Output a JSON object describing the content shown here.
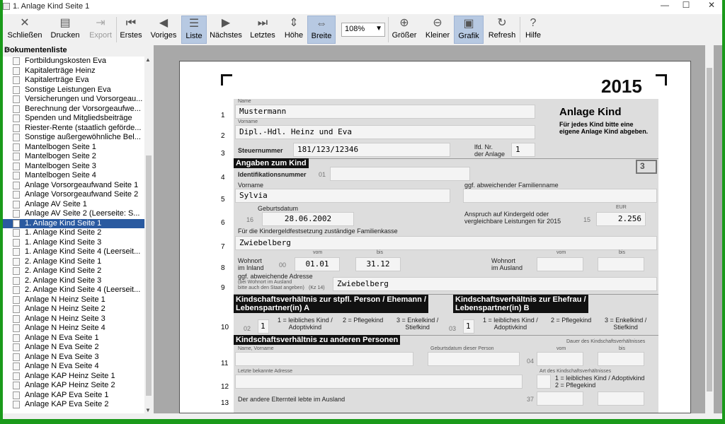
{
  "window": {
    "title": "1. Anlage Kind Seite 1",
    "minimize": "—",
    "maximize": "☐",
    "close": "✕"
  },
  "toolbar": {
    "schliessen": "Schließen",
    "drucken": "Drucken",
    "export": "Export",
    "erstes": "Erstes",
    "voriges": "Voriges",
    "liste": "Liste",
    "naechstes": "Nächstes",
    "letztes": "Letztes",
    "hoehe": "Höhe",
    "breite": "Breite",
    "zoom": "108%",
    "groesser": "Größer",
    "kleiner": "Kleiner",
    "grafik": "Grafik",
    "refresh": "Refresh",
    "hilfe": "Hilfe"
  },
  "sidebar": {
    "title": "Dokumentenliste",
    "items": [
      "Fortbildungskosten Eva",
      "Kapitalerträge Heinz",
      "Kapitalerträge Eva",
      "Sonstige Leistungen Eva",
      "Versicherungen und Vorsorgeau...",
      "Berechnung der Vorsorgeaufwe...",
      "Spenden und Mitgliedsbeiträge",
      "Riester-Rente (staatlich geförde...",
      "Sonstige außergewöhnliche Bel...",
      "Mantelbogen Seite 1",
      "Mantelbogen Seite 2",
      "Mantelbogen Seite 3",
      "Mantelbogen Seite 4",
      "Anlage Vorsorgeaufwand Seite 1",
      "Anlage Vorsorgeaufwand Seite 2",
      "Anlage AV Seite 1",
      "Anlage AV Seite 2 (Leerseite: S...",
      "1. Anlage Kind Seite 1",
      "1. Anlage Kind Seite 2",
      "1. Anlage Kind Seite 3",
      "1. Anlage Kind Seite 4 (Leerseit...",
      "2. Anlage Kind Seite 1",
      "2. Anlage Kind Seite 2",
      "2. Anlage Kind Seite 3",
      "2. Anlage Kind Seite 4 (Leerseit...",
      "Anlage N Heinz Seite 1",
      "Anlage N Heinz Seite 2",
      "Anlage N Heinz Seite 3",
      "Anlage N Heinz Seite 4",
      "Anlage N Eva Seite 1",
      "Anlage N Eva Seite 2",
      "Anlage N Eva Seite 3",
      "Anlage N Eva Seite 4",
      "Anlage KAP Heinz Seite 1",
      "Anlage KAP Heinz Seite 2",
      "Anlage KAP Eva Seite 1",
      "Anlage KAP Eva Seite 2"
    ],
    "selected_index": 17
  },
  "form": {
    "year": "2015",
    "title": "Anlage Kind",
    "subtitle1": "Für jedes Kind bitte eine",
    "subtitle2": "eigene Anlage Kind abgeben.",
    "name_label": "Name",
    "name": "Mustermann",
    "vorname_label": "Vorname",
    "vorname": "Dipl.-Hdl. Heinz und Eva",
    "steuernummer_label": "Steuernummer",
    "steuernummer": "181/123/12346",
    "lfd_label1": "lfd. Nr.",
    "lfd_label2": "der Anlage",
    "lfd": "1",
    "angaben_header": "Angaben zum Kind",
    "box_no": "3",
    "idnr_label": "Identifikationsnummer",
    "idnr_code": "01",
    "kind_vorname_label": "Vorname",
    "kind_vorname": "Sylvia",
    "fam_label": "ggf. abweichender Familienname",
    "geburtsdatum_label": "Geburtsdatum",
    "geb_code": "16",
    "geburtsdatum": "28.06.2002",
    "anspruch1": "Anspruch auf Kindergeld oder",
    "anspruch2": "vergleichbare Leistungen für 2015",
    "eur_label": "EUR",
    "kg_code": "15",
    "kindergeld": "2.256",
    "fk_label": "Für die Kindergeldfestsetzung zuständige Familienkasse",
    "familienkasse": "Zwiebelberg",
    "wohnort_label1": "Wohnort",
    "wohnort_label2": "im Inland",
    "wo_code": "00",
    "vom_label": "vom",
    "bis_label": "bis",
    "vom": "01.01",
    "bis": "31.12",
    "ausland1": "Wohnort",
    "ausland2": "im Ausland",
    "adr_label": "ggf. abweichende Adresse",
    "adr_small1": "(bei Wohnort im Ausland",
    "adr_small2": "bitte auch den Staat angeben)",
    "adr_code": "(Kz 14)",
    "adresse": "Zwiebelberg",
    "ks1_header1": "Kindschaftsverhältnis zur stpfl. Person / Ehemann /",
    "ks1_header2": "Lebenspartner(in) A",
    "ks2_header1": "Kindschaftsverhältnis zur Ehefrau /",
    "ks2_header2": "Lebenspartner(in) B",
    "code_02": "02",
    "ks_a": "1",
    "code_03": "03",
    "ks_b": "1",
    "opt1a": "1 = leibliches Kind /",
    "opt1b": "Adoptivkind",
    "opt2": "2 = Pflegekind",
    "opt3a": "3 = Enkelkind /",
    "opt3b": "Stiefkind",
    "andere_header": "Kindschaftsverhältnis zu anderen Personen",
    "name_vorname": "Name, Vorname",
    "geb_dieser": "Geburtsdatum dieser Person",
    "dauer": "Dauer des Kindschaftsverhältnisses",
    "code_04": "04",
    "letzte_adresse": "Letzte bekannte Adresse",
    "art": "Art des Kindschaftsverhältnisses",
    "art1": "1 = leibliches Kind / Adoptivkind",
    "art2": "2 = Pflegekind",
    "ausland_text": "Der andere Elternteil lebte im Ausland",
    "code_37": "37",
    "lines": [
      "1",
      "2",
      "3",
      "4",
      "5",
      "6",
      "7",
      "8",
      "9",
      "10",
      "11",
      "12",
      "13"
    ]
  }
}
